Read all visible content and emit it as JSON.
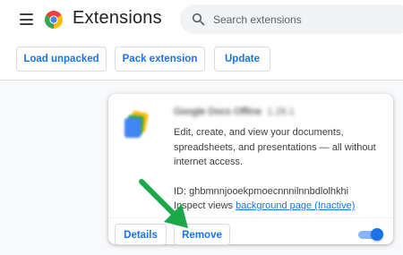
{
  "header": {
    "title": "Extensions",
    "menu_icon": "hamburger-menu-icon",
    "logo_icon": "chrome-logo-icon"
  },
  "search": {
    "placeholder": "Search extensions",
    "icon": "search-icon"
  },
  "toolbar": {
    "load_unpacked_label": "Load unpacked",
    "pack_extension_label": "Pack extension",
    "update_label": "Update"
  },
  "extension_card": {
    "name": "Google Docs Offline",
    "version": "1.28.1",
    "description": "Edit, create, and view your documents, spreadsheets, and presentations — all without internet access.",
    "id_label": "ID: ",
    "id_value": "ghbmnnjooekpmoecnnnilnnbdlolhkhi",
    "inspect_label": "Inspect views ",
    "inspect_link": "background page (Inactive)",
    "details_label": "Details",
    "remove_label": "Remove",
    "enabled": true
  },
  "annotation": {
    "arrow_color": "#1aa84a",
    "points_to": "remove-button"
  },
  "colors": {
    "accent": "#1a73e8",
    "background": "#f8f9fa",
    "arrow": "#1aa84a"
  }
}
